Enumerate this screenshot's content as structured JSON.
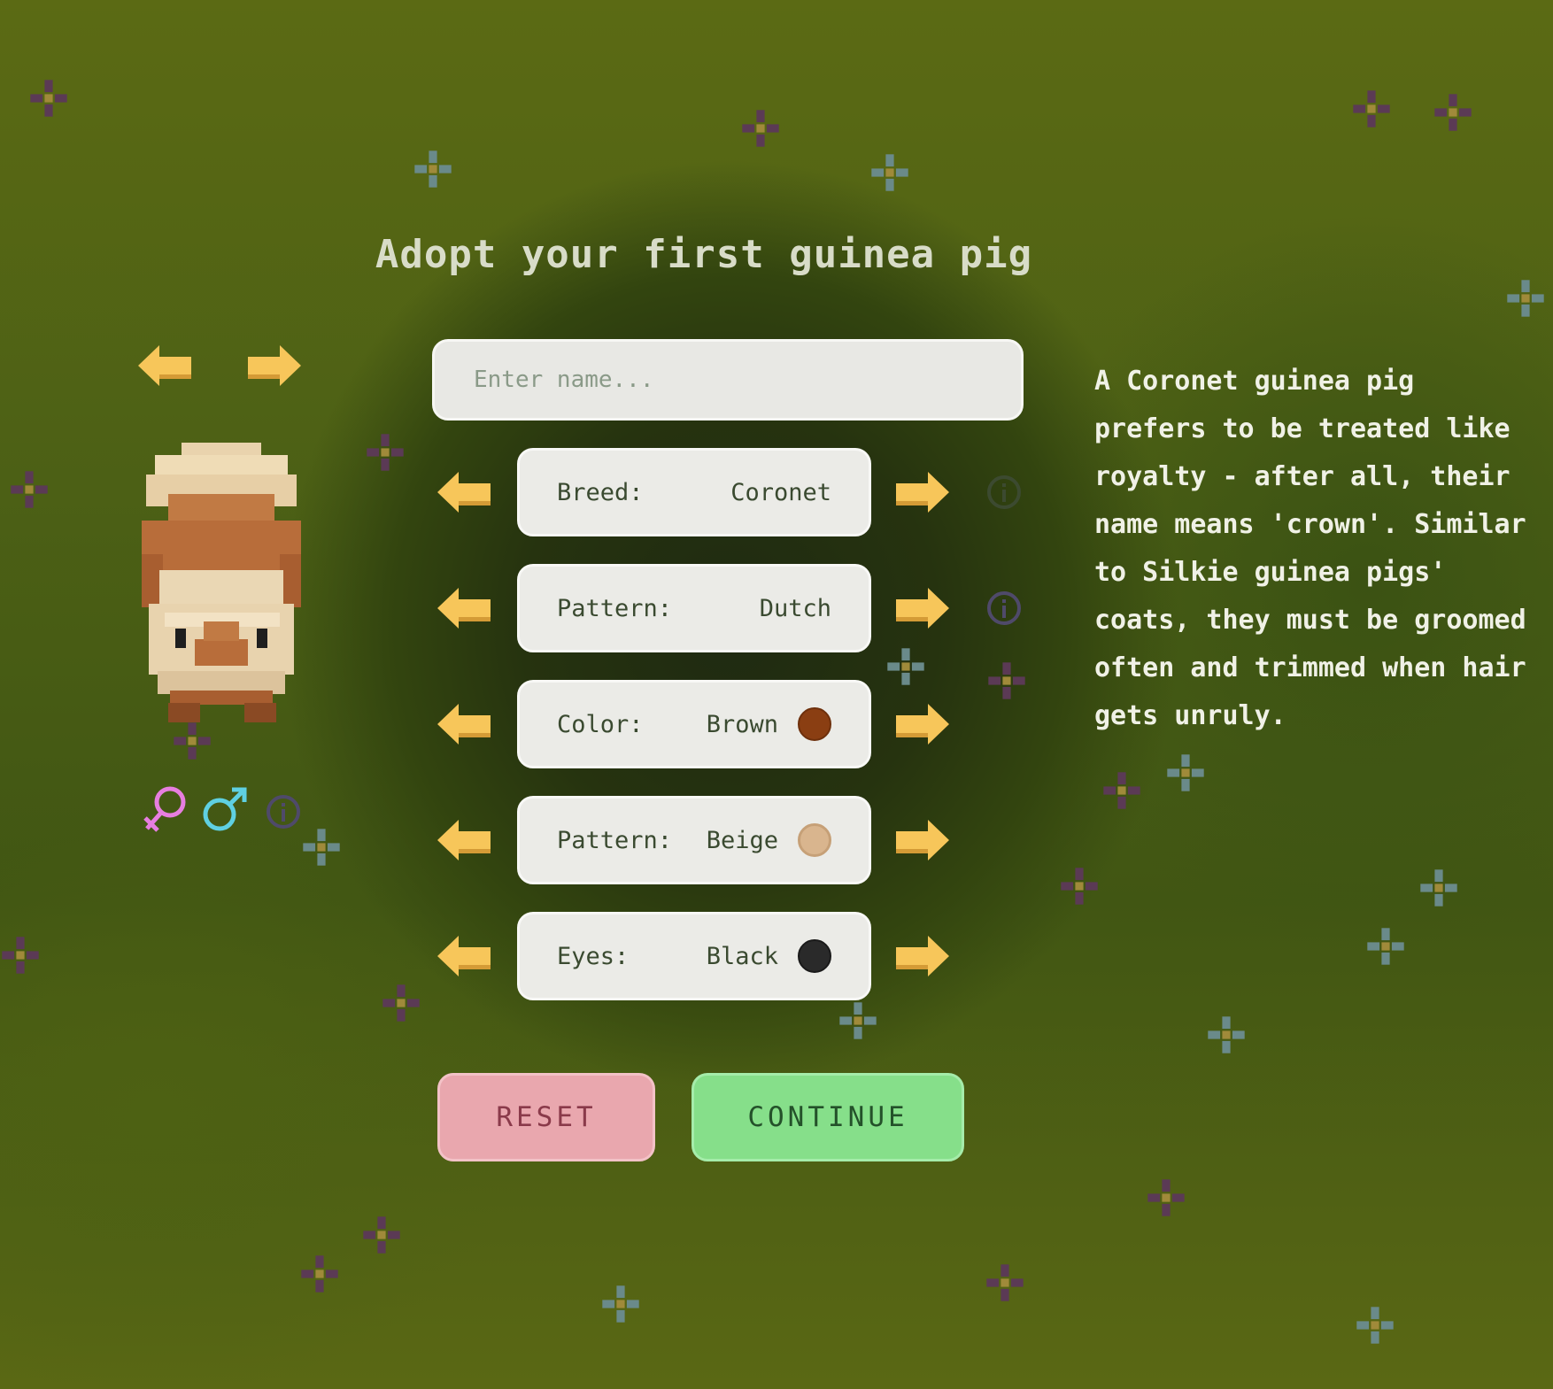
{
  "title": "Adopt your first guinea pig",
  "name_input": {
    "placeholder": "Enter name...",
    "value": ""
  },
  "options": [
    {
      "label": "Breed:",
      "value": "Coronet",
      "swatch": null,
      "info": true
    },
    {
      "label": "Pattern:",
      "value": "Dutch",
      "swatch": null,
      "info": true
    },
    {
      "label": "Color:",
      "value": "Brown",
      "swatch": "#8a3e12",
      "info": false
    },
    {
      "label": "Pattern:",
      "value": "Beige",
      "swatch": "#d9b58e",
      "info": false
    },
    {
      "label": "Eyes:",
      "value": "Black",
      "swatch": "#2a2a2a",
      "info": false
    }
  ],
  "description": "A Coronet guinea pig prefers to be treated like royalty - after all, their name means 'crown'. Similar to Silkie guinea pigs' coats, they must be groomed often and trimmed when hair gets unruly.",
  "buttons": {
    "reset": "RESET",
    "continue": "CONTINUE"
  },
  "icons": {
    "arrow_left": "arrow-left-icon",
    "arrow_right": "arrow-right-icon",
    "info": "info-icon",
    "female": "female-symbol-icon",
    "male": "male-symbol-icon"
  },
  "colors": {
    "arrow": "#f7c65a",
    "female": "#e77ee0",
    "male": "#5fd0e2",
    "info": "#4f4a6a",
    "reset_bg": "#e9a7ae",
    "continue_bg": "#86df8a"
  }
}
